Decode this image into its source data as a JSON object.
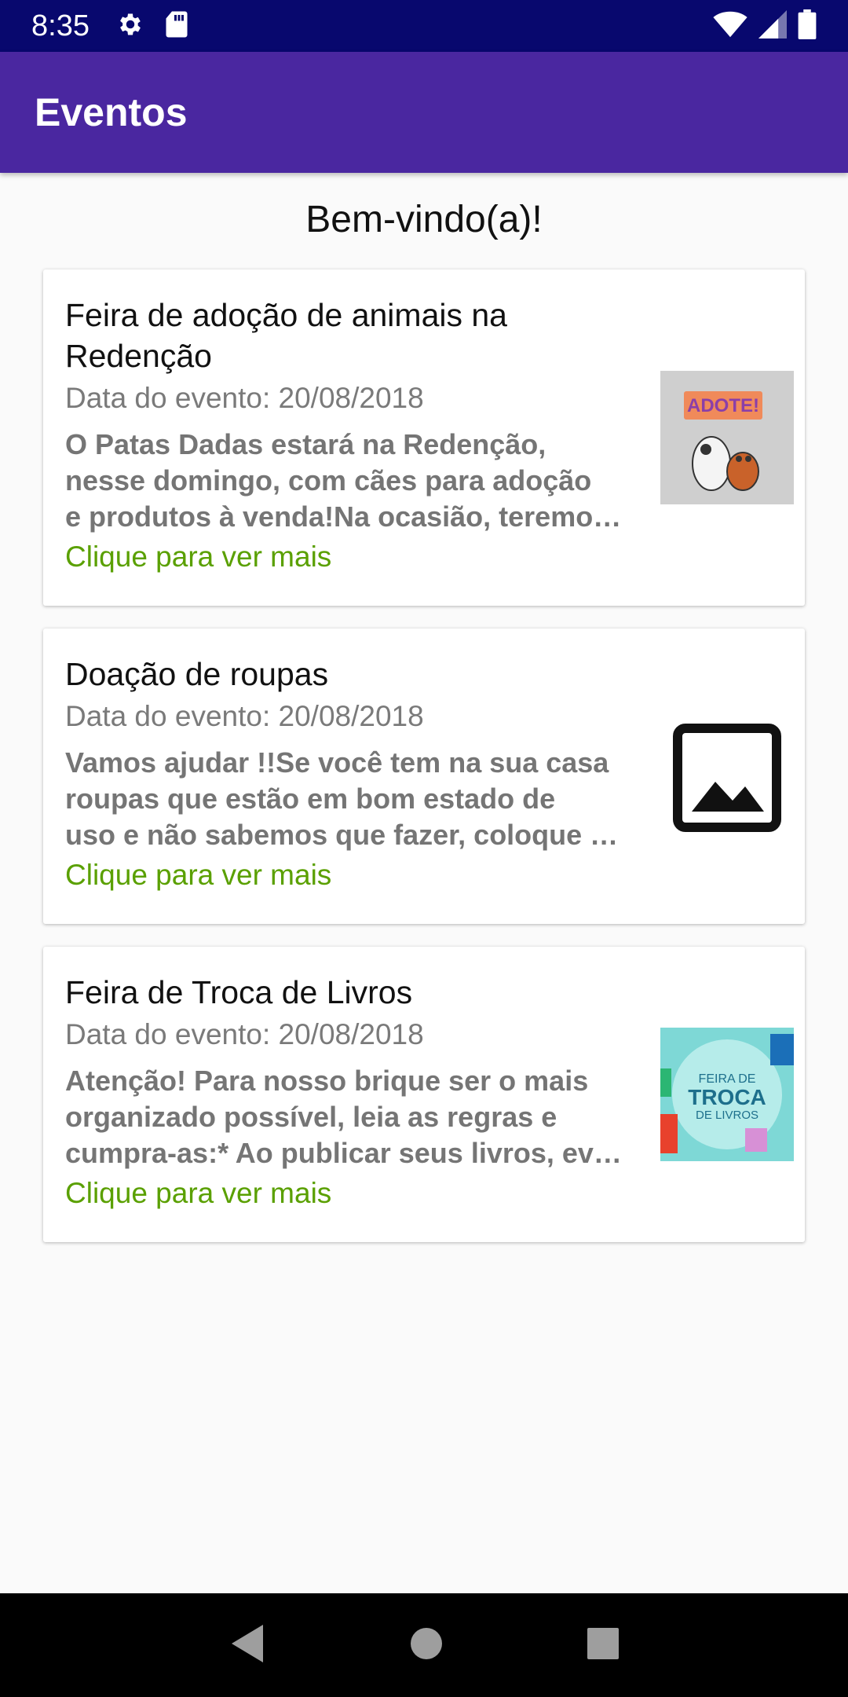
{
  "status_bar": {
    "time": "8:35",
    "icons": [
      "settings-icon",
      "sd-card-icon",
      "wifi-icon",
      "signal-icon",
      "battery-icon"
    ]
  },
  "app_bar": {
    "title": "Eventos"
  },
  "welcome": "Bem-vindo(a)!",
  "events": [
    {
      "title_lines": [
        "Feira de adoção de animais na",
        "Redenção"
      ],
      "date": "Data do evento: 20/08/2018",
      "desc_lines": [
        "O Patas Dadas estará na Redenção,",
        "nesse domingo, com cães para adoção",
        "e produtos à venda!Na ocasião, teremo…"
      ],
      "more": "Clique para ver mais",
      "thumb_text": "ADOTE!"
    },
    {
      "title_lines": [
        "Doação de roupas"
      ],
      "date": "Data do evento: 20/08/2018",
      "desc_lines": [
        "Vamos ajudar !!Se você tem na sua casa",
        "roupas que estão em bom estado de",
        "uso e não sabemos que fazer, coloque …"
      ],
      "more": "Clique para ver mais"
    },
    {
      "title_lines": [
        "Feira de Troca de Livros"
      ],
      "date": "Data do evento: 20/08/2018",
      "desc_lines": [
        "Atenção! Para nosso brique ser o mais",
        "organizado possível, leia as regras e",
        "cumpra-as:* Ao publicar seus livros, ev…"
      ],
      "more": "Clique para ver mais",
      "thumb_lines": [
        "FEIRA DE",
        "TROCA",
        "DE LIVROS"
      ]
    }
  ],
  "colors": {
    "status_bar": "#08086e",
    "app_bar": "#4a27a0",
    "link": "#5aa000",
    "background": "#fafafa"
  },
  "nav": [
    "back-icon",
    "home-icon",
    "recents-icon"
  ]
}
